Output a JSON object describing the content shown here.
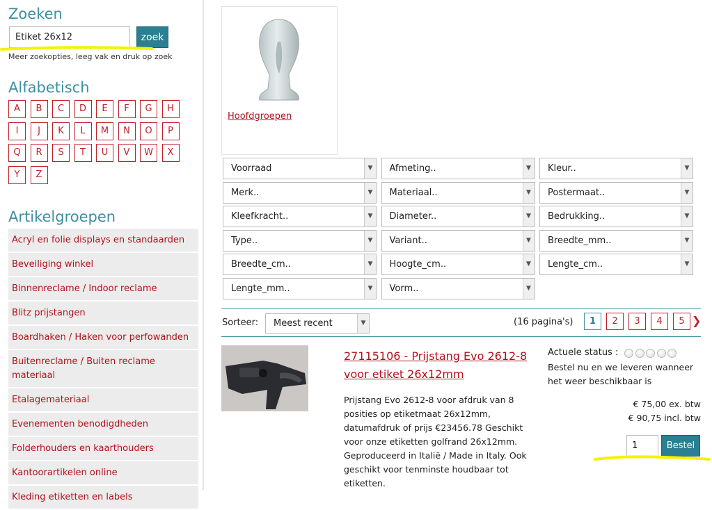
{
  "search": {
    "heading": "Zoeken",
    "value": "Etiket 26x12",
    "button": "zoek",
    "hint": "Meer zoekopties, leeg vak en druk op zoek"
  },
  "alphabet": {
    "heading": "Alfabetisch",
    "letters": [
      "A",
      "B",
      "C",
      "D",
      "E",
      "F",
      "G",
      "H",
      "I",
      "J",
      "K",
      "L",
      "M",
      "N",
      "O",
      "P",
      "Q",
      "R",
      "S",
      "T",
      "U",
      "V",
      "W",
      "X",
      "Y",
      "Z"
    ]
  },
  "categories": {
    "heading": "Artikelgroepen",
    "items": [
      "Acryl en folie displays en standaarden",
      "Beveiliging winkel",
      "Binnenreclame / Indoor reclame",
      "Blitz prijstangen",
      "Boardhaken / Haken voor perfowanden",
      "Buitenreclame / Buiten reclame materiaal",
      "Etalagemateriaal",
      "Evenementen benodigdheden",
      "Folderhouders en kaarthouders",
      "Kantoorartikelen online",
      "Kleding etiketten en labels"
    ]
  },
  "group_tile": {
    "label": "Hoofdgroepen"
  },
  "filters": [
    [
      "Voorraad",
      "Afmeting..",
      "Kleur.."
    ],
    [
      "Merk..",
      "Materiaal..",
      "Postermaat.."
    ],
    [
      "Kleefkracht..",
      "Diameter..",
      "Bedrukking.."
    ],
    [
      "Type..",
      "Variant..",
      "Breedte_mm.."
    ],
    [
      "Breedte_cm..",
      "Hoogte_cm..",
      "Lengte_cm.."
    ],
    [
      "Lengte_mm..",
      "Vorm.."
    ]
  ],
  "sort": {
    "label": "Sorteer:",
    "value": "Meest recent"
  },
  "pagination": {
    "count_text": "(16 pagina's)",
    "pages": [
      "1",
      "2",
      "3",
      "4",
      "5"
    ],
    "active": "1",
    "next": "❯"
  },
  "product": {
    "title": "27115106 - Prijstang Evo 2612-8 voor etiket 26x12mm",
    "description": "Prijstang Evo 2612-8 voor afdruk van 8 posities op etiketmaat 26x12mm, datumafdruk of prijs €23456.78 Geschikt voor onze etiketten golfrand 26x12mm. Geproduceerd in Italië / Made in Italy. Ook geschikt voor tenminste houdbaar tot etiketten.",
    "status_label": "Actuele status :",
    "status_rating": 0,
    "status_text": "Bestel nu en we leveren wanneer het weer beschikbaar is",
    "price_ex": "€ 75,00 ex. btw",
    "price_incl": "€ 90,75 incl. btw",
    "quantity": "1",
    "order_button": "Bestel"
  },
  "colors": {
    "accent": "#3e8fa0",
    "button": "#2b7f92",
    "link": "#b0121c",
    "highlight": "#f3f300"
  }
}
